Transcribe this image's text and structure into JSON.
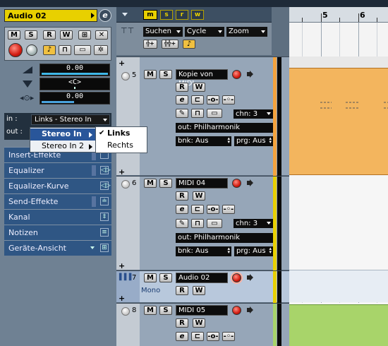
{
  "colors": {
    "accent_yellow": "#e8d000",
    "highlight_blue": "#29569a",
    "midi_part": "#f3b55e",
    "audio_part": "#a8d46a",
    "record": "#d11b10"
  },
  "inspector": {
    "track_name": "Audio 02",
    "e_label": "e",
    "buttons": {
      "mute": "M",
      "solo": "S",
      "read": "R",
      "write": "W"
    },
    "volume": "0.00",
    "pan": "<C>",
    "delay": "0.00",
    "in_label": "in :",
    "in_value": "Links - Stereo In",
    "out_label": "out :",
    "sections": [
      {
        "label": "Insert-Effekte",
        "icon": "insert-icon",
        "glyph": ""
      },
      {
        "label": "Equalizer",
        "icon": "eq-icon",
        "glyph": "◁▷"
      },
      {
        "label": "Equalizer-Kurve",
        "icon": "eq-curve-icon",
        "glyph": "◁▷"
      },
      {
        "label": "Send-Effekte",
        "icon": "send-icon",
        "glyph": "≐"
      },
      {
        "label": "Kanal",
        "icon": "channel-icon",
        "glyph": "‡"
      },
      {
        "label": "Notizen",
        "icon": "notes-icon",
        "glyph": "≡"
      },
      {
        "label": "Geräte-Ansicht",
        "icon": "device-icon",
        "glyph": "⊞"
      }
    ]
  },
  "menu": {
    "items": [
      "Stereo In",
      "Stereo In 2"
    ],
    "highlighted": "Stereo In",
    "submenu": [
      "Links",
      "Rechts"
    ],
    "checked": "Links"
  },
  "tracklist": {
    "header_buttons": [
      "m",
      "s",
      "r",
      "w"
    ],
    "filters": [
      "Suchen",
      "Cycle",
      "Zoom"
    ],
    "tracks": [
      {
        "num": "5",
        "name": "Kopie von MIDI",
        "chn": "chn: 3",
        "out": "out: Philharmonik",
        "bnk": "bnk: Aus",
        "prg": "prg: Aus"
      },
      {
        "num": "6",
        "name": "MIDI 04",
        "chn": "chn: 3",
        "out": "out: Philharmonik",
        "bnk": "bnk: Aus",
        "prg": "prg: Aus"
      },
      {
        "num": "7",
        "name": "Audio 02",
        "mode": "Mono"
      },
      {
        "num": "8",
        "name": "MIDI 05"
      }
    ]
  },
  "ruler": {
    "bars": [
      "5",
      "6"
    ]
  }
}
